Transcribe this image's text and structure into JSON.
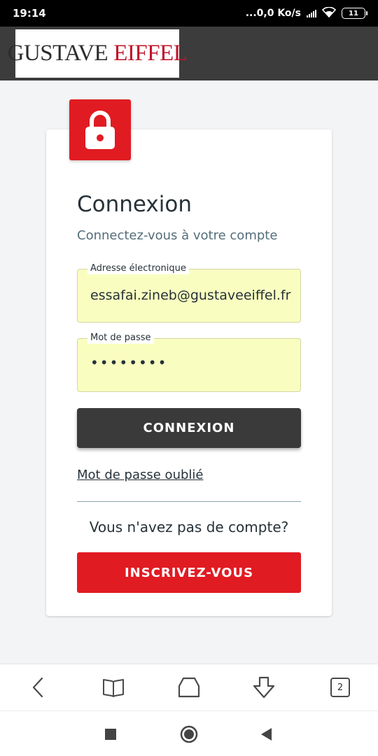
{
  "status_bar": {
    "time": "19:14",
    "network_speed": "...0,0 Ko/s",
    "battery_level": "11",
    "icons": [
      "signal-icon",
      "wifi-icon",
      "battery-icon"
    ]
  },
  "header": {
    "logo_part1": "GUSTAVE",
    "logo_part2": "EIFFEL"
  },
  "login": {
    "title": "Connexion",
    "subtitle": "Connectez-vous à votre compte",
    "email_label": "Adresse électronique",
    "email_value": "essafai.zineb@gustaveeiffel.fr",
    "password_label": "Mot de passe",
    "password_value": "••••••••",
    "submit_label": "CONNEXION",
    "forgot_label": "Mot de passe oublié",
    "no_account_text": "Vous n'avez pas de compte?",
    "signup_label": "INSCRIVEZ-VOUS"
  },
  "browser_nav": {
    "tab_count": "2",
    "icons": [
      "back-icon",
      "bookmarks-icon",
      "home-icon",
      "download-icon",
      "tabs-icon"
    ]
  },
  "colors": {
    "brand_red": "#e11b22",
    "header_dark": "#3c3c3c",
    "field_fill": "#f9fec0",
    "button_dark": "#3a3a3a"
  }
}
